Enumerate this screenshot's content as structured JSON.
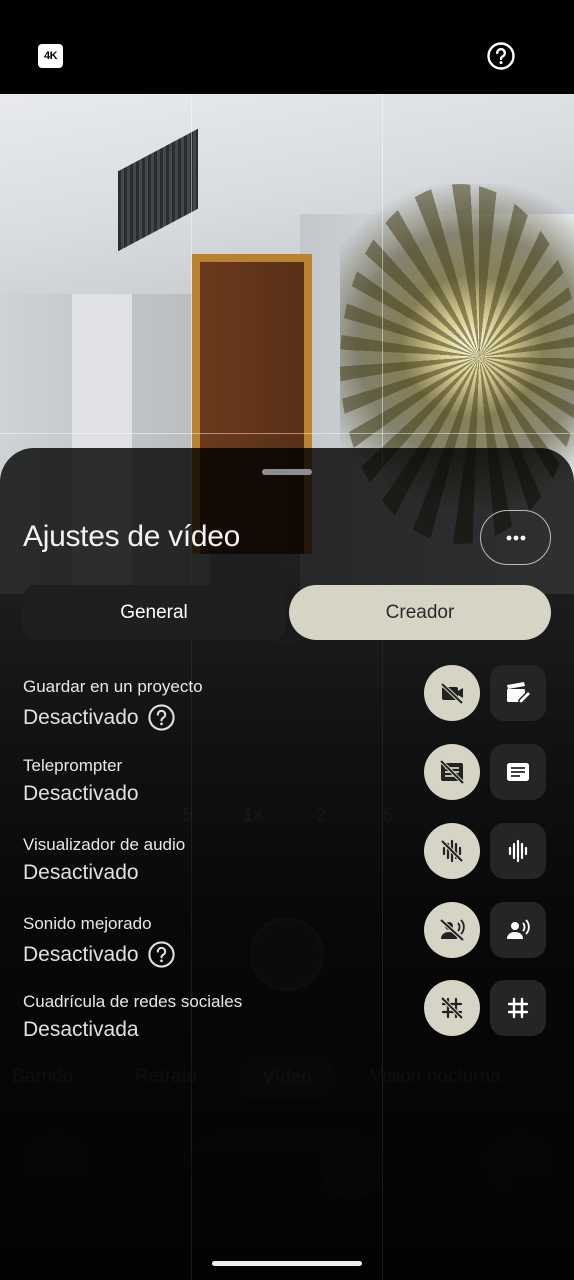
{
  "top_bar": {
    "badge_label": "4K",
    "help_icon": "help-circle-icon"
  },
  "background": {
    "zoom_levels": [
      ".5",
      "1×",
      "2",
      "5"
    ],
    "active_zoom": "1×",
    "modes": [
      "Barrido",
      "Retrato",
      "Vídeo",
      "Visión nocturna"
    ],
    "active_mode": "Vídeo"
  },
  "sheet": {
    "title": "Ajustes de vídeo",
    "more_icon": "more-horizontal-icon",
    "tabs": [
      {
        "label": "General",
        "selected": false
      },
      {
        "label": "Creador",
        "selected": true
      }
    ],
    "settings": [
      {
        "title": "Guardar en un proyecto",
        "status": "Desactivado",
        "has_help": true,
        "off_icon": "video-project-off-icon",
        "on_icon": "video-project-edit-icon"
      },
      {
        "title": "Teleprompter",
        "status": "Desactivado",
        "has_help": false,
        "off_icon": "teleprompter-off-icon",
        "on_icon": "teleprompter-icon"
      },
      {
        "title": "Visualizador de audio",
        "status": "Desactivado",
        "has_help": false,
        "off_icon": "audio-visualizer-off-icon",
        "on_icon": "audio-visualizer-icon"
      },
      {
        "title": "Sonido mejorado",
        "status": "Desactivado",
        "has_help": true,
        "off_icon": "voice-enhance-off-icon",
        "on_icon": "voice-enhance-icon"
      },
      {
        "title": "Cuadrícula de redes sociales",
        "status": "Desactivada",
        "has_help": false,
        "off_icon": "grid-off-icon",
        "on_icon": "grid-icon"
      }
    ]
  },
  "colors": {
    "accent": "#d5d4c5",
    "sheet_bg": "#000000",
    "dark_button": "#242525"
  }
}
